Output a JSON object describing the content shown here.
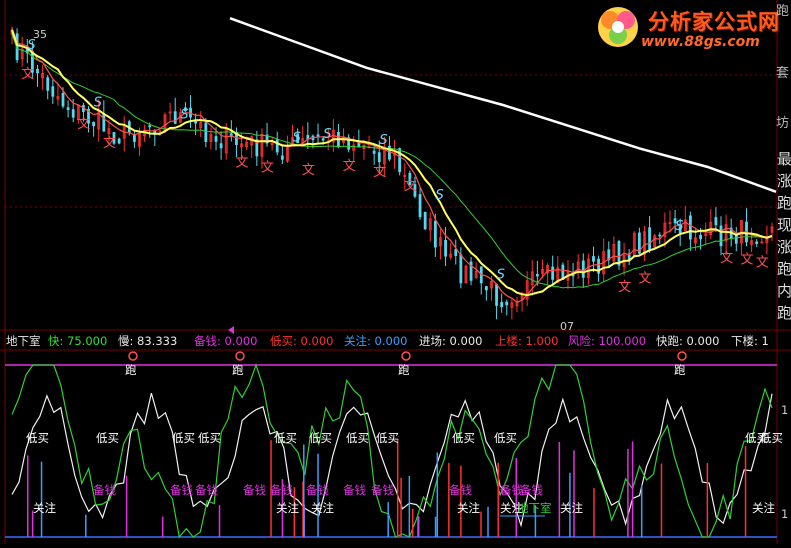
{
  "watermark": {
    "site_name": "分析家公式网",
    "url": "www.88gs.com"
  },
  "upper_panel": {
    "price_high_label": "35",
    "price_low_label": "07",
    "buy_marker": "文",
    "sell_marker": "S",
    "right_edge_glyphs": [
      "跑",
      "套",
      "坊"
    ],
    "right_side_labels": [
      "最",
      "涨",
      "跑",
      "现",
      "涨",
      "跑",
      "内",
      "跑"
    ]
  },
  "indicator_bar": {
    "name": "地下室",
    "items": [
      {
        "label": "快:",
        "value": "75.000",
        "color": "#30e030"
      },
      {
        "label": "慢:",
        "value": "83.333",
        "color": "#e8e8e8"
      },
      {
        "label": "备钱:",
        "value": "0.000",
        "color": "#e030e0"
      },
      {
        "label": "低买:",
        "value": "0.000",
        "color": "#ff3030"
      },
      {
        "label": "关注:",
        "value": "0.000",
        "color": "#3aa0ff"
      },
      {
        "label": "进场:",
        "value": "0.000",
        "color": "#e8e8e8"
      },
      {
        "label": "上楼:",
        "value": "1.000",
        "color": "#ff3030"
      },
      {
        "label": "风险:",
        "value": "100.000",
        "color": "#e030e0"
      },
      {
        "label": "快跑:",
        "value": "0.000",
        "color": "#e8e8e8"
      },
      {
        "label": "下楼:",
        "value": "1",
        "color": "#e8e8e8"
      }
    ]
  },
  "lower_panel": {
    "labels": {
      "run": "跑",
      "low_buy": "低买",
      "prepare_money": "备钱",
      "watch": "关注",
      "basement": "地下室"
    },
    "right_axis_glyphs": [
      "1",
      "1"
    ]
  },
  "colors": {
    "background": "#000000",
    "up_candle": "#ff3030",
    "down_candle": "#54d8f0",
    "ma_white": "#ffffff",
    "ma_yellow": "#ffff60",
    "ma_green": "#30d030",
    "ma_red": "#ff5050",
    "grid_red": "#7a0000",
    "magenta": "#e030e0"
  },
  "chart_data": [
    {
      "type": "line",
      "title": "",
      "description_series": [
        {
          "name": "",
          "role": "long moving average (white)",
          "y_pct": [
            2,
            10,
            18,
            24,
            30,
            37,
            44,
            50,
            58
          ]
        },
        {
          "name": "",
          "role": "price trend",
          "y_pct": [
            10,
            30,
            40,
            33,
            42,
            44,
            40,
            46,
            80,
            92,
            85,
            80,
            70,
            72,
            70
          ]
        }
      ],
      "markers": {
        "buy_count": 14,
        "sell_count": 9
      }
    },
    {
      "type": "line",
      "title": "地下室",
      "series": [
        {
          "name": "快",
          "value": 75.0
        },
        {
          "name": "慢",
          "value": 83.333
        }
      ],
      "ylim": [
        0,
        100
      ],
      "signals": {
        "run_count": 5,
        "low_buy_count": 12,
        "prepare_money_count": 11,
        "watch_count": 7,
        "basement_count": 1
      }
    }
  ]
}
